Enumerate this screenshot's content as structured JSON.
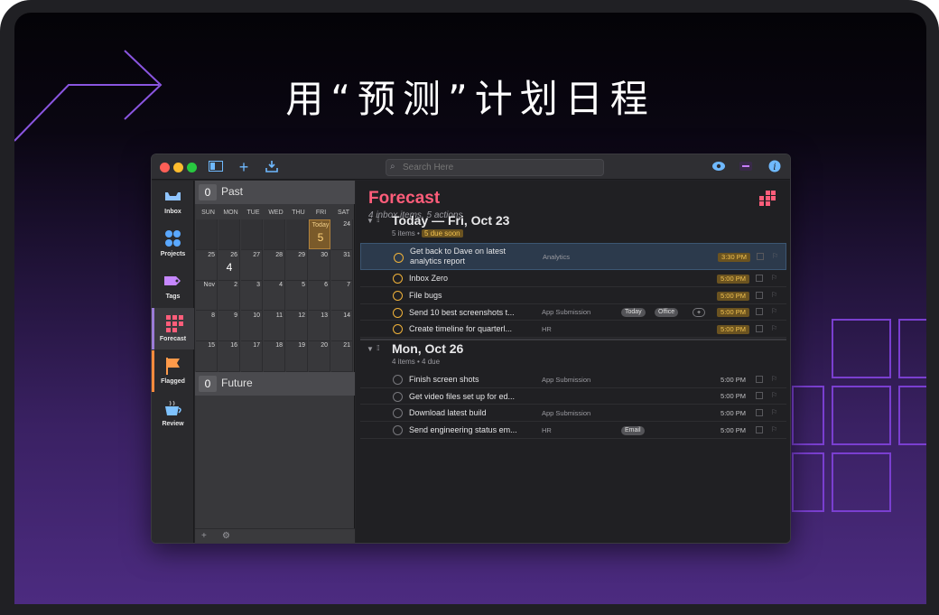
{
  "headline": "用“预测”计划日程",
  "toolbar": {
    "search_placeholder": "Search Here",
    "icons": [
      "sidebar-toggle-icon",
      "add-icon",
      "download-icon",
      "eye-icon",
      "focus-icon",
      "info-icon"
    ]
  },
  "sidebar": {
    "items": [
      {
        "label": "Inbox",
        "icon": "inbox-icon"
      },
      {
        "label": "Projects",
        "icon": "projects-icon"
      },
      {
        "label": "Tags",
        "icon": "tag-icon"
      },
      {
        "label": "Forecast",
        "icon": "forecast-icon"
      },
      {
        "label": "Flagged",
        "icon": "flag-icon"
      },
      {
        "label": "Review",
        "icon": "review-icon"
      }
    ]
  },
  "calendar": {
    "past": {
      "count": "0",
      "label": "Past"
    },
    "future": {
      "count": "0",
      "label": "Future"
    },
    "dow": [
      "SUN",
      "MON",
      "TUE",
      "WED",
      "THU",
      "FRI",
      "SAT"
    ],
    "today_label": "Today",
    "today_count": "5",
    "row1": [
      "",
      "",
      "",
      "",
      "",
      "",
      "24"
    ],
    "row2": [
      "25",
      "26",
      "27",
      "28",
      "29",
      "30",
      "31"
    ],
    "row2_count": "4",
    "row3": [
      "Nov",
      "2",
      "3",
      "4",
      "5",
      "6",
      "7"
    ],
    "row4": [
      "8",
      "9",
      "10",
      "11",
      "12",
      "13",
      "14"
    ],
    "row5": [
      "15",
      "16",
      "17",
      "18",
      "19",
      "20",
      "21"
    ],
    "footer_add": "+",
    "footer_gear": "⚙"
  },
  "forecast": {
    "title": "Forecast",
    "subtitle": "4 inbox items, 5 actions",
    "sections": [
      {
        "title": "Today — Fri, Oct 23",
        "meta": "5 items • ",
        "badge": "5 due soon",
        "rows": [
          {
            "title": "Get back to Dave on latest analytics report",
            "project": "Analytics",
            "tags": [],
            "time": "3:30 PM"
          },
          {
            "title": "Inbox Zero",
            "project": "",
            "tags": [],
            "time": "5:00 PM"
          },
          {
            "title": "File bugs",
            "project": "",
            "tags": [],
            "time": "5:00 PM"
          },
          {
            "title": "Send 10 best screenshots t...",
            "project": "App Submission",
            "tags": [
              "Today",
              "Office",
              "+"
            ],
            "time": "5:00 PM"
          },
          {
            "title": "Create timeline for quarterl...",
            "project": "HR",
            "tags": [],
            "time": "5:00 PM"
          }
        ]
      },
      {
        "title": "Mon, Oct 26",
        "meta": "4 items • 4 due",
        "rows": [
          {
            "title": "Finish screen shots",
            "project": "App Submission",
            "tags": [],
            "time": "5:00 PM"
          },
          {
            "title": "Get video files set up for ed...",
            "project": "",
            "tags": [],
            "time": "5:00 PM"
          },
          {
            "title": "Download latest build",
            "project": "App Submission",
            "tags": [],
            "time": "5:00 PM"
          },
          {
            "title": "Send engineering status em...",
            "project": "HR",
            "tags": [
              "Email"
            ],
            "time": "5:00 PM"
          }
        ]
      }
    ]
  },
  "colors": {
    "accent_forecast": "#ff5d7a",
    "due": "#f2c24f",
    "toolbar_icon": "#6fb9ff"
  }
}
